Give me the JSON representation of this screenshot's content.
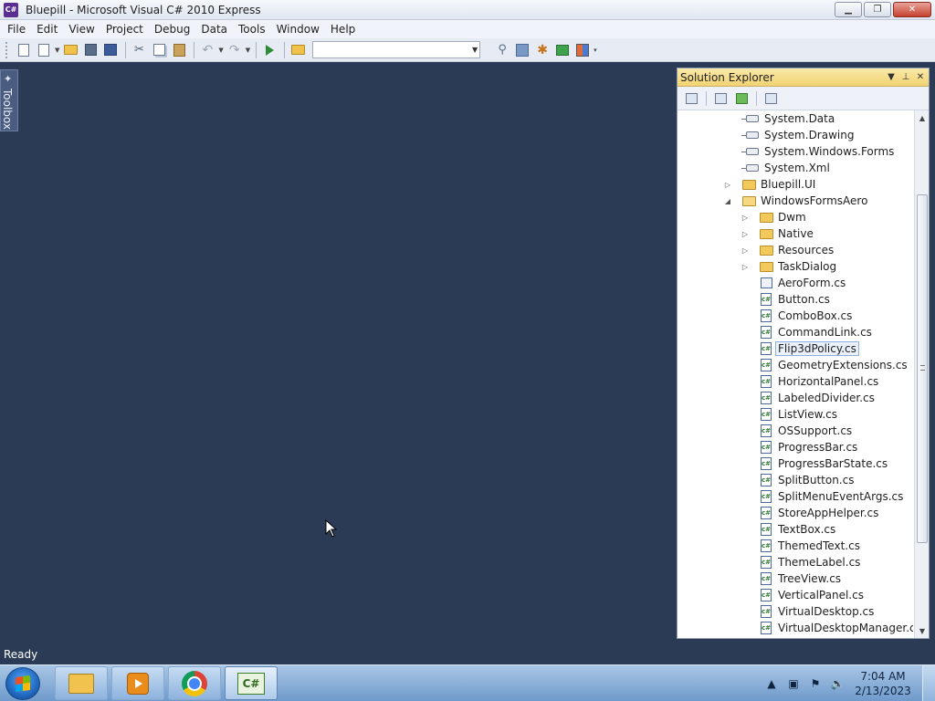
{
  "window": {
    "title": "Bluepill - Microsoft Visual C# 2010 Express",
    "app_icon": "C#",
    "minimize": "▁",
    "maximize": "❐",
    "close": "✕"
  },
  "menu": [
    "File",
    "Edit",
    "View",
    "Project",
    "Debug",
    "Data",
    "Tools",
    "Window",
    "Help"
  ],
  "toolbar": {
    "config_combo_value": ""
  },
  "toolbox": {
    "label": "Toolbox",
    "icon": "✦"
  },
  "solution_explorer": {
    "title": "Solution Explorer",
    "tree": [
      {
        "label": "System.Data",
        "level": 3,
        "icon": "reference-icon",
        "expander": ""
      },
      {
        "label": "System.Drawing",
        "level": 3,
        "icon": "reference-icon",
        "expander": ""
      },
      {
        "label": "System.Windows.Forms",
        "level": 3,
        "icon": "reference-icon",
        "expander": ""
      },
      {
        "label": "System.Xml",
        "level": 3,
        "icon": "reference-icon",
        "expander": ""
      },
      {
        "label": "Bluepill.UI",
        "level": 1,
        "icon": "folder-icon",
        "expander": "▷"
      },
      {
        "label": "WindowsFormsAero",
        "level": 1,
        "icon": "folder-open-icon",
        "expander": "◢"
      },
      {
        "label": "Dwm",
        "level": 2,
        "icon": "folder-icon",
        "expander": "▷"
      },
      {
        "label": "Native",
        "level": 2,
        "icon": "folder-icon",
        "expander": "▷"
      },
      {
        "label": "Resources",
        "level": 2,
        "icon": "folder-icon",
        "expander": "▷"
      },
      {
        "label": "TaskDialog",
        "level": 2,
        "icon": "folder-icon",
        "expander": "▷"
      },
      {
        "label": "AeroForm.cs",
        "level": 2,
        "icon": "form-icon",
        "expander": ""
      },
      {
        "label": "Button.cs",
        "level": 2,
        "icon": "cs-file-icon",
        "expander": ""
      },
      {
        "label": "ComboBox.cs",
        "level": 2,
        "icon": "cs-file-icon",
        "expander": ""
      },
      {
        "label": "CommandLink.cs",
        "level": 2,
        "icon": "cs-file-icon",
        "expander": ""
      },
      {
        "label": "Flip3dPolicy.cs",
        "level": 2,
        "icon": "cs-file-icon",
        "expander": "",
        "selected": true
      },
      {
        "label": "GeometryExtensions.cs",
        "level": 2,
        "icon": "cs-file-icon",
        "expander": ""
      },
      {
        "label": "HorizontalPanel.cs",
        "level": 2,
        "icon": "cs-file-icon",
        "expander": ""
      },
      {
        "label": "LabeledDivider.cs",
        "level": 2,
        "icon": "cs-file-icon",
        "expander": ""
      },
      {
        "label": "ListView.cs",
        "level": 2,
        "icon": "cs-file-icon",
        "expander": ""
      },
      {
        "label": "OSSupport.cs",
        "level": 2,
        "icon": "cs-file-icon",
        "expander": ""
      },
      {
        "label": "ProgressBar.cs",
        "level": 2,
        "icon": "cs-file-icon",
        "expander": ""
      },
      {
        "label": "ProgressBarState.cs",
        "level": 2,
        "icon": "cs-file-icon",
        "expander": ""
      },
      {
        "label": "SplitButton.cs",
        "level": 2,
        "icon": "cs-file-icon",
        "expander": ""
      },
      {
        "label": "SplitMenuEventArgs.cs",
        "level": 2,
        "icon": "cs-file-icon",
        "expander": ""
      },
      {
        "label": "StoreAppHelper.cs",
        "level": 2,
        "icon": "cs-file-icon",
        "expander": ""
      },
      {
        "label": "TextBox.cs",
        "level": 2,
        "icon": "cs-file-icon",
        "expander": ""
      },
      {
        "label": "ThemedText.cs",
        "level": 2,
        "icon": "cs-file-icon",
        "expander": ""
      },
      {
        "label": "ThemeLabel.cs",
        "level": 2,
        "icon": "cs-file-icon",
        "expander": ""
      },
      {
        "label": "TreeView.cs",
        "level": 2,
        "icon": "cs-file-icon",
        "expander": ""
      },
      {
        "label": "VerticalPanel.cs",
        "level": 2,
        "icon": "cs-file-icon",
        "expander": ""
      },
      {
        "label": "VirtualDesktop.cs",
        "level": 2,
        "icon": "cs-file-icon",
        "expander": ""
      },
      {
        "label": "VirtualDesktopManager.cs",
        "level": 2,
        "icon": "cs-file-icon",
        "expander": ""
      }
    ]
  },
  "status": {
    "text": "Ready"
  },
  "taskbar": {
    "items": [
      "explorer-icon",
      "media-player-icon",
      "chrome-icon",
      "visual-csharp-icon"
    ],
    "active_app_label": "C#",
    "clock_time": "7:04 AM",
    "clock_date": "2/13/2023"
  },
  "colors": {
    "workspace": "#2b3a55",
    "explorer_header": "#f2d373",
    "taskbar": "#8db3de"
  }
}
